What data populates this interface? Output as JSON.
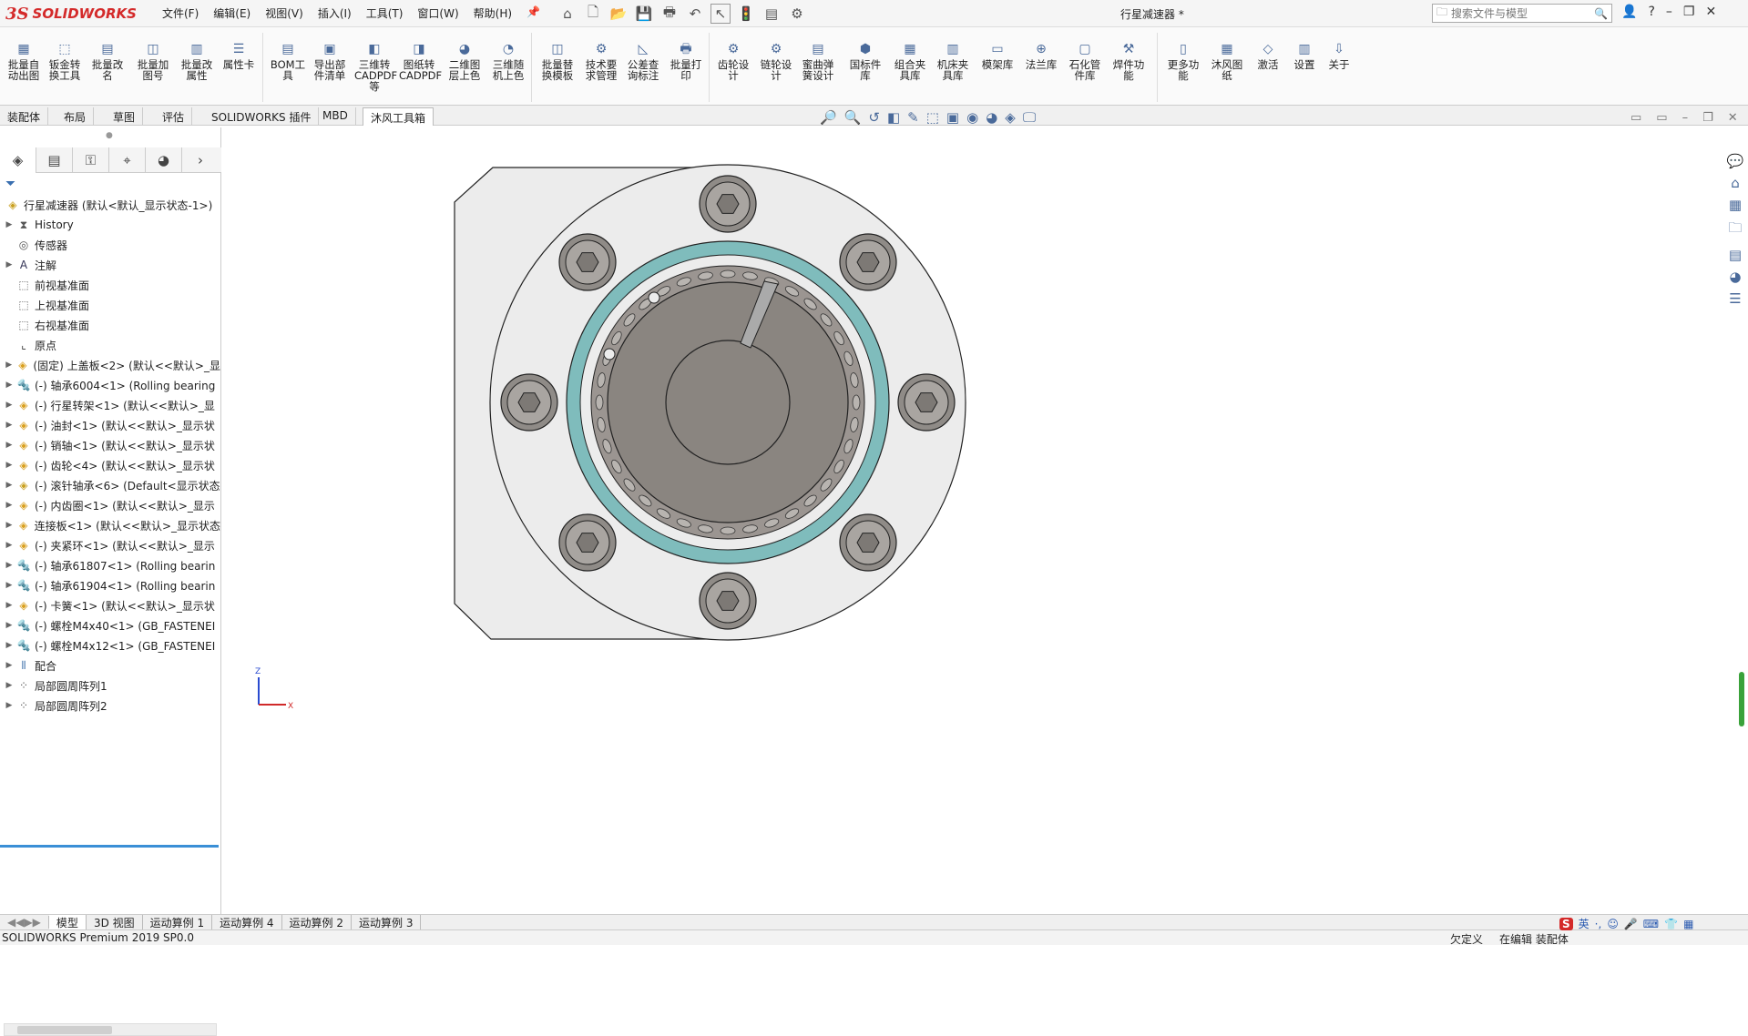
{
  "app": {
    "logo_ds": "3S",
    "logo_name": "SOLIDWORKS",
    "document_title": "行星减速器 *",
    "search_placeholder": "搜索文件与模型"
  },
  "menu": [
    "文件(F)",
    "编辑(E)",
    "视图(V)",
    "插入(I)",
    "工具(T)",
    "窗口(W)",
    "帮助(H)"
  ],
  "ribbon": [
    {
      "label": "批量自\n动出图"
    },
    {
      "label": "钣金转\n换工具"
    },
    {
      "label": "批量改\n名"
    },
    {
      "label": "批量加\n图号"
    },
    {
      "label": "批量改\n属性"
    },
    {
      "label": "属性卡"
    },
    {
      "label": "BOM工\n具"
    },
    {
      "label": "导出部\n件清单"
    },
    {
      "label": "三维转\nCADPDF\n等"
    },
    {
      "label": "图纸转\nCADPDF"
    },
    {
      "label": "二维图\n层上色"
    },
    {
      "label": "三维随\n机上色"
    },
    {
      "label": "批量替\n换模板"
    },
    {
      "label": "技术要\n求管理"
    },
    {
      "label": "公差查\n询标注"
    },
    {
      "label": "批量打\n印"
    },
    {
      "label": "齿轮设\n计"
    },
    {
      "label": "链轮设\n计"
    },
    {
      "label": "蜜曲弹\n簧设计"
    },
    {
      "label": "国标件\n库"
    },
    {
      "label": "组合夹\n具库"
    },
    {
      "label": "机床夹\n具库"
    },
    {
      "label": "模架库"
    },
    {
      "label": "法兰库"
    },
    {
      "label": "石化管\n件库"
    },
    {
      "label": "焊件功\n能"
    },
    {
      "label": "更多功\n能"
    },
    {
      "label": "沐风图\n纸"
    },
    {
      "label": "激活"
    },
    {
      "label": "设置"
    },
    {
      "label": "关于"
    }
  ],
  "command_tabs": [
    "装配体",
    "布局",
    "草图",
    "评估",
    "SOLIDWORKS 插件",
    "MBD",
    "沐风工具箱"
  ],
  "tree": {
    "root": "行星减速器 (默认<默认_显示状态-1>)",
    "items": [
      {
        "label": "History",
        "icon": "history-icon",
        "expand": true
      },
      {
        "label": "传感器",
        "icon": "sensor-icon",
        "expand": false
      },
      {
        "label": "注解",
        "icon": "annotation-icon",
        "expand": true
      },
      {
        "label": "前视基准面",
        "icon": "plane-icon",
        "expand": false
      },
      {
        "label": "上视基准面",
        "icon": "plane-icon",
        "expand": false
      },
      {
        "label": "右视基准面",
        "icon": "plane-icon",
        "expand": false
      },
      {
        "label": "原点",
        "icon": "origin-icon",
        "expand": false
      },
      {
        "label": "(固定) 上盖板<2> (默认<<默认>_显",
        "icon": "part-icon",
        "expand": true
      },
      {
        "label": "(-) 轴承6004<1> (Rolling bearing",
        "icon": "toolbox-icon",
        "expand": true
      },
      {
        "label": "(-) 行星转架<1> (默认<<默认>_显",
        "icon": "part-icon",
        "expand": true
      },
      {
        "label": "(-) 油封<1> (默认<<默认>_显示状",
        "icon": "part-icon",
        "expand": true
      },
      {
        "label": "(-) 销轴<1> (默认<<默认>_显示状",
        "icon": "part-icon",
        "expand": true
      },
      {
        "label": "(-) 齿轮<4> (默认<<默认>_显示状",
        "icon": "part-icon",
        "expand": true
      },
      {
        "label": "(-) 滚针轴承<6> (Default<显示状态",
        "icon": "assembly-icon",
        "expand": true
      },
      {
        "label": "(-) 内齿圈<1> (默认<<默认>_显示",
        "icon": "part-icon",
        "expand": true
      },
      {
        "label": "连接板<1> (默认<<默认>_显示状态",
        "icon": "part-icon",
        "expand": true
      },
      {
        "label": "(-) 夹紧环<1> (默认<<默认>_显示",
        "icon": "part-icon",
        "expand": true
      },
      {
        "label": "(-) 轴承61807<1> (Rolling bearin",
        "icon": "toolbox-icon",
        "expand": true
      },
      {
        "label": "(-) 轴承61904<1> (Rolling bearin",
        "icon": "toolbox-icon",
        "expand": true
      },
      {
        "label": "(-) 卡簧<1> (默认<<默认>_显示状",
        "icon": "part-icon",
        "expand": true
      },
      {
        "label": "(-) 螺栓M4x40<1> (GB_FASTENEI",
        "icon": "toolbox-icon",
        "expand": true
      },
      {
        "label": "(-) 螺栓M4x12<1> (GB_FASTENEI",
        "icon": "toolbox-icon",
        "expand": true
      },
      {
        "label": "配合",
        "icon": "mates-icon",
        "expand": true
      },
      {
        "label": "局部圆周阵列1",
        "icon": "pattern-icon",
        "expand": true
      },
      {
        "label": "局部圆周阵列2",
        "icon": "pattern-icon",
        "expand": true
      }
    ]
  },
  "bottom_tabs": [
    "模型",
    "3D 视图",
    "运动算例 1",
    "运动算例 4",
    "运动算例 2",
    "运动算例 3"
  ],
  "status": {
    "left": "SOLIDWORKS Premium 2019 SP0.0",
    "under_defined": "欠定义",
    "editing": "在编辑 装配体"
  },
  "triad": {
    "z": "Z",
    "x": "X"
  },
  "ime": {
    "lang": "英"
  },
  "colors": {
    "plate": "#ececec",
    "bearing_ring": "#7fbcbc",
    "bolt": "#8f8b87",
    "gear": "#8a8580",
    "logo": "#d42a2a"
  }
}
